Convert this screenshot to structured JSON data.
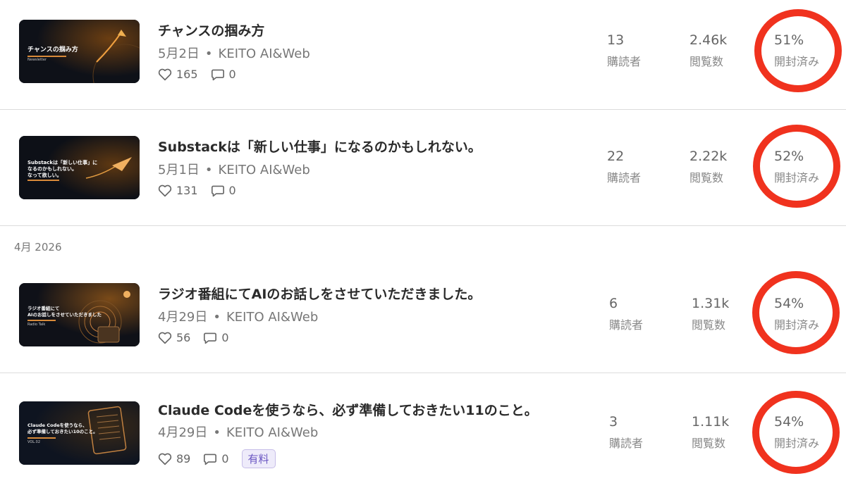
{
  "section_label": "4月 2026",
  "posts": [
    {
      "title": "チャンスの掴み方",
      "date": "5月2日",
      "dot": "•",
      "publication": "KEITO AI&Web",
      "likes": "165",
      "comments": "0",
      "subscribers": "13",
      "subscribers_label": "購読者",
      "views": "2.46k",
      "views_label": "閲覧数",
      "open_rate": "51%",
      "open_rate_label": "開封済み",
      "thumb_title": "チャンスの掴み方",
      "thumb_sub": "Newsletter",
      "paid": null
    },
    {
      "title": "Substackは「新しい仕事」になるのかもしれない。",
      "date": "5月1日",
      "dot": "•",
      "publication": "KEITO AI&Web",
      "likes": "131",
      "comments": "0",
      "subscribers": "22",
      "subscribers_label": "購読者",
      "views": "2.22k",
      "views_label": "閲覧数",
      "open_rate": "52%",
      "open_rate_label": "開封済み",
      "thumb_title": "Substackは「新しい仕事」に\nなるのかもしれない。\nなって欲しい。",
      "thumb_sub": "",
      "paid": null
    },
    {
      "title": "ラジオ番組にてAIのお話しをさせていただきました。",
      "date": "4月29日",
      "dot": "•",
      "publication": "KEITO AI&Web",
      "likes": "56",
      "comments": "0",
      "subscribers": "6",
      "subscribers_label": "購読者",
      "views": "1.31k",
      "views_label": "閲覧数",
      "open_rate": "54%",
      "open_rate_label": "開封済み",
      "thumb_title": "ラジオ番組にて\nAIのお話しをさせていただきました",
      "thumb_sub": "Radio Talk",
      "paid": null
    },
    {
      "title": "Claude Codeを使うなら、必ず準備しておきたい11のこと。",
      "date": "4月29日",
      "dot": "•",
      "publication": "KEITO AI&Web",
      "likes": "89",
      "comments": "0",
      "subscribers": "3",
      "subscribers_label": "購読者",
      "views": "1.11k",
      "views_label": "閲覧数",
      "open_rate": "54%",
      "open_rate_label": "開封済み",
      "thumb_title": "Claude Codeを使うなら、\n必ず準備しておきたい10のこと。",
      "thumb_sub": "VOL.02",
      "paid": "有料"
    }
  ],
  "colors": {
    "highlight_circle": "#f0321e",
    "accent_line": "#d88a3a",
    "paid_badge": "#6a56c2"
  }
}
